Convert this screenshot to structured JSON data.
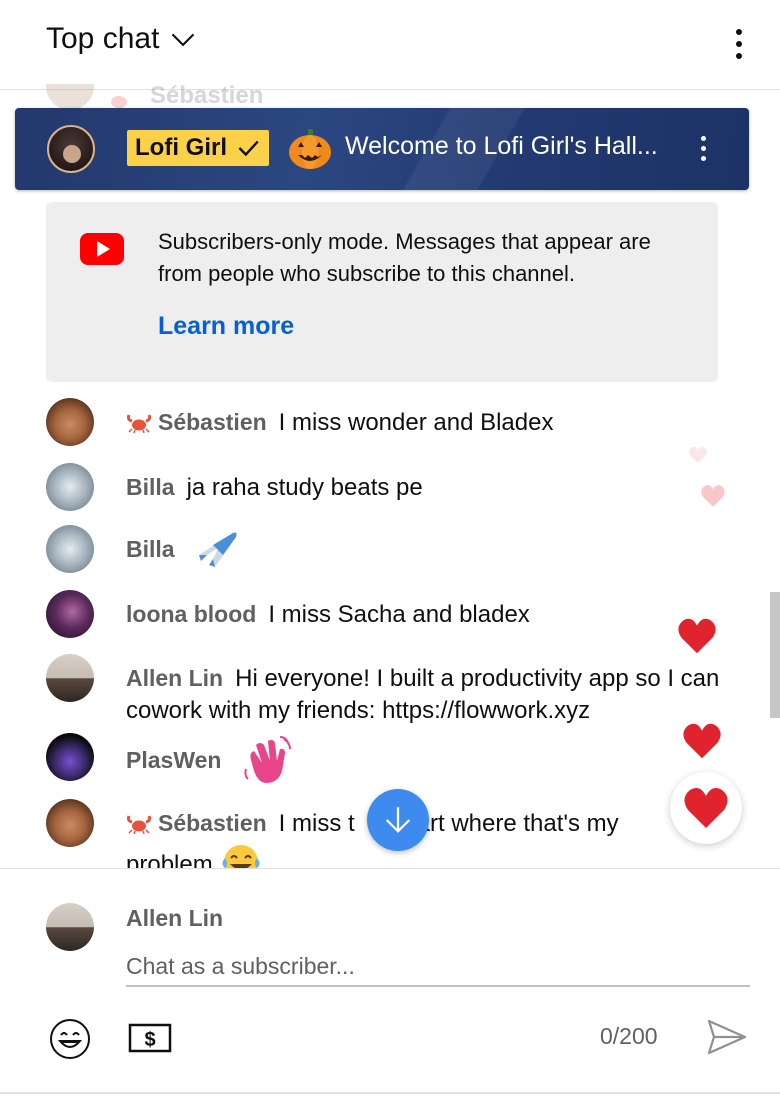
{
  "header": {
    "title": "Top chat",
    "menu_icon": "more-vert-icon"
  },
  "peek": {
    "author": "Sébastien"
  },
  "pinned": {
    "badge_label": "Lofi Girl",
    "message": "Welcome to Lofi Girl's Hall...",
    "badge_color": "#fcd14a",
    "background": "#23386b"
  },
  "notice": {
    "text": "Subscribers-only mode. Messages that appear are from people who subscribe to this channel.",
    "link": "Learn more",
    "link_color": "#065fd4"
  },
  "messages": [
    {
      "author": "Sébastien",
      "text": "I miss wonder and Bladex",
      "badge_icon": "crab-icon"
    },
    {
      "author": "Billa",
      "text": "ja raha study beats pe"
    },
    {
      "author": "Billa",
      "text": "",
      "emoji": "airplane-emoji"
    },
    {
      "author": "loona blood",
      "text": "I miss Sacha and bladex"
    },
    {
      "author": "Allen Lin",
      "text": "Hi everyone! I built a productivity app so I can cowork with my friends: https://flowwork.xyz"
    },
    {
      "author": "PlasWen",
      "text": "",
      "emoji": "waving-hand-emoji"
    },
    {
      "author": "Sébastien",
      "text_before": "I miss t",
      "text_after": "art where that's my problem",
      "emoji": "tears-of-joy-emoji",
      "badge_icon": "crab-icon"
    }
  ],
  "input": {
    "author": "Allen Lin",
    "placeholder": "Chat as a subscriber...",
    "counter": "0/200"
  },
  "colors": {
    "author_gray": "#606060",
    "accent_blue": "#3d8bef",
    "heart_red": "#e0242e"
  }
}
